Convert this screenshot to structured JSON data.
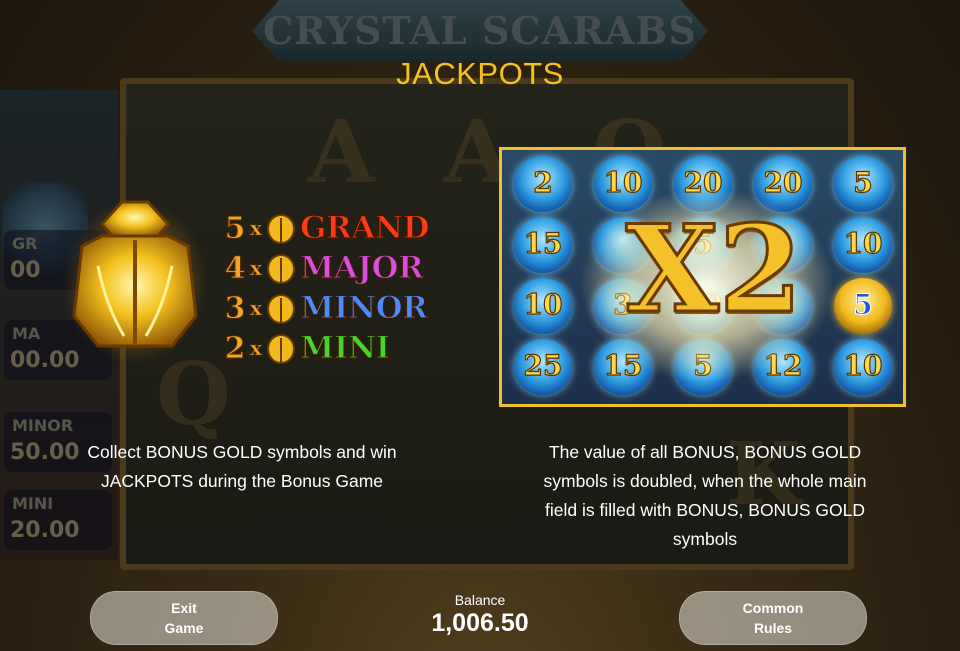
{
  "background": {
    "game_title": "CRYSTAL SCARABS",
    "side_jackpots": [
      {
        "label": "GR",
        "value": "00"
      },
      {
        "label": "MA",
        "value": "00.00"
      },
      {
        "label": "MINOR",
        "value": "50.00"
      },
      {
        "label": "MINI",
        "value": "20.00"
      }
    ],
    "reel_letters": [
      "A",
      "A",
      "Q",
      "Q",
      "K"
    ]
  },
  "heading": "JACKPOTS",
  "jackpots": [
    {
      "count": "5",
      "times": "x",
      "name": "GRAND",
      "color": "#ff3a1a"
    },
    {
      "count": "4",
      "times": "x",
      "name": "MAJOR",
      "color": "#d84fe0"
    },
    {
      "count": "3",
      "times": "x",
      "name": "MINOR",
      "color": "#4a8cff"
    },
    {
      "count": "2",
      "times": "x",
      "name": "MINI",
      "color": "#46d42e"
    }
  ],
  "example_grid": {
    "cells": [
      [
        "2",
        "10",
        "20",
        "20",
        "5"
      ],
      [
        "15",
        "",
        "5",
        "",
        "10"
      ],
      [
        "10",
        "3",
        "10",
        "",
        "5"
      ],
      [
        "25",
        "15",
        "5",
        "12",
        "10"
      ]
    ],
    "gold_cells": [
      [
        2,
        4
      ]
    ],
    "multiplier": "X2"
  },
  "descriptions": {
    "left_line1": "Collect BONUS GOLD symbols and win",
    "left_line2": "JACKPOTS during the Bonus Game",
    "right_line1": "The value of all BONUS, BONUS GOLD",
    "right_line2": "symbols is doubled, when the whole main",
    "right_line3": "field is filled with BONUS, BONUS GOLD",
    "right_line4": "symbols"
  },
  "footer": {
    "exit_line1": "Exit",
    "exit_line2": "Game",
    "balance_label": "Balance",
    "balance_value": "1,006.50",
    "rules_line1": "Common",
    "rules_line2": "Rules"
  },
  "colors": {
    "heading": "#f2c21f",
    "grid_border": "#f0c030",
    "text": "#ffffff"
  }
}
